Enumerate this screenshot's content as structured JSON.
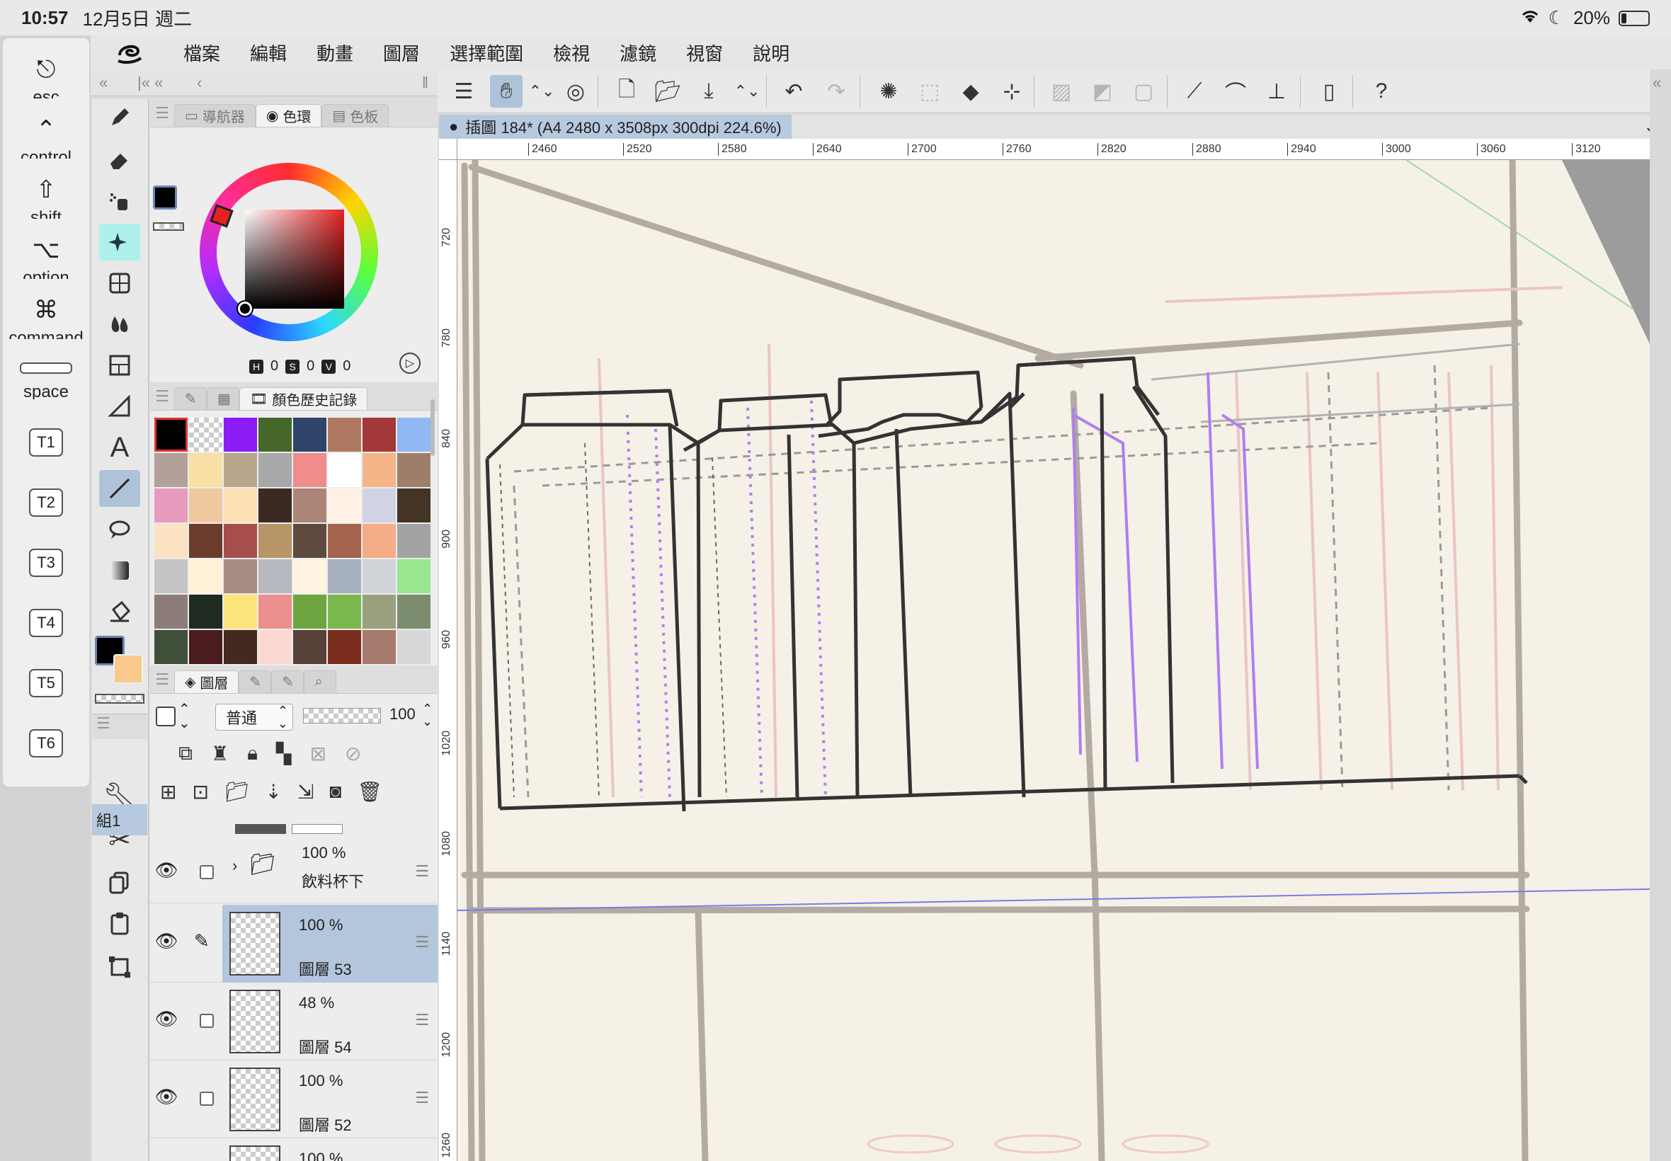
{
  "status": {
    "time": "10:57",
    "date": "12月5日 週二",
    "battery": "20%",
    "battery_level": 0.2
  },
  "modifier_keys": [
    {
      "id": "esc",
      "label": "esc",
      "glyph": "⎋",
      "icon": "esc-icon"
    },
    {
      "id": "control",
      "label": "control",
      "glyph": "⌃",
      "icon": "control-icon"
    },
    {
      "id": "shift",
      "label": "shift",
      "glyph": "⇧",
      "icon": "shift-icon"
    },
    {
      "id": "option",
      "label": "option",
      "glyph": "⌥",
      "icon": "option-icon"
    },
    {
      "id": "command",
      "label": "command",
      "glyph": "⌘",
      "icon": "command-icon"
    },
    {
      "id": "space",
      "label": "space",
      "glyph": "",
      "icon": "space-bar-icon"
    },
    {
      "id": "t1",
      "label": "T1"
    },
    {
      "id": "t2",
      "label": "T2"
    },
    {
      "id": "t3",
      "label": "T3"
    },
    {
      "id": "t4",
      "label": "T4"
    },
    {
      "id": "t5",
      "label": "T5"
    },
    {
      "id": "t6",
      "label": "T6"
    }
  ],
  "menubar": {
    "items": [
      "檔案",
      "編輯",
      "動畫",
      "圖層",
      "選擇範圍",
      "檢視",
      "濾鏡",
      "視窗",
      "說明"
    ]
  },
  "color_panel": {
    "tabs": [
      "導航器",
      "色環",
      "色板"
    ],
    "active_tab": 1,
    "hsv": {
      "h_label": "H",
      "h": "0",
      "s_label": "S",
      "s": "0",
      "v_label": "V",
      "v": "0"
    },
    "main_color": "#000000",
    "sub_color": "#f9c98c"
  },
  "history_panel": {
    "title": "顏色歷史記錄",
    "swatches": [
      "#000000",
      "checker",
      "#8a1cf4",
      "#46672a",
      "#2f4468",
      "#b07a62",
      "#a33838",
      "#8fb8f4",
      "#b3a09a",
      "#f8dfa3",
      "#b8a68c",
      "#a8a8aa",
      "#f08c8c",
      "#ffffff",
      "#f4b487",
      "#9e7e6b",
      "#e79bbd",
      "#f0c89e",
      "#fbe0b3",
      "#3c2a22",
      "#ac8578",
      "#fff2e4",
      "#cfd3e3",
      "#433423",
      "#fbe2c2",
      "#6b3b2c",
      "#a64e4b",
      "#b89567",
      "#5e4a3f",
      "#a4644e",
      "#f4ad87",
      "#a3a3a3",
      "#c4c4c4",
      "#fff2d9",
      "#a78b85",
      "#b6b9c0",
      "#fff3e1",
      "#a6b0c0",
      "#d0d3d8",
      "#99e890",
      "#8c7d78",
      "#1f2a20",
      "#fde47a",
      "#ec8f8f",
      "#6da641",
      "#7ab84e",
      "#9aa07d",
      "#7c8c6e",
      "#3f4f3a",
      "#4a1c1e",
      "#44291e",
      "#fbd9d0",
      "#564038",
      "#7a2d1c",
      "#a67a6c",
      "#d7d7d7"
    ],
    "selected_index": 0
  },
  "layer_panel": {
    "title": "圖層",
    "blend_mode": "普通",
    "opacity": "100",
    "group_label": "組1",
    "rows": [
      {
        "pct": "100 %",
        "name": "飲料杯下",
        "type": "folder",
        "selected": false
      },
      {
        "pct": "100 %",
        "name": "圖層 53",
        "type": "raster",
        "selected": true
      },
      {
        "pct": "48 %",
        "name": "圖層 54",
        "type": "raster",
        "selected": false
      },
      {
        "pct": "100 %",
        "name": "圖層 52",
        "type": "raster",
        "selected": false
      },
      {
        "pct": "100 %",
        "name": "",
        "type": "raster",
        "selected": false
      }
    ]
  },
  "document": {
    "title": "插圖 184* (A4 2480 x 3508px 300dpi 224.6%)"
  },
  "ruler": {
    "h_ticks": [
      "2460",
      "2520",
      "2580",
      "2640",
      "2700",
      "2760",
      "2820",
      "2880",
      "2940",
      "3000",
      "3060",
      "3120"
    ],
    "v_ticks": [
      "720",
      "780",
      "840",
      "900",
      "960",
      "1020",
      "1080",
      "1140",
      "1200",
      "1260"
    ]
  },
  "colors": {
    "accent": "#aec3d9",
    "canvas": "#f5f1e7",
    "sketch": "#b3aaa2",
    "ink": "#333333",
    "guide": "#b07ef0"
  }
}
